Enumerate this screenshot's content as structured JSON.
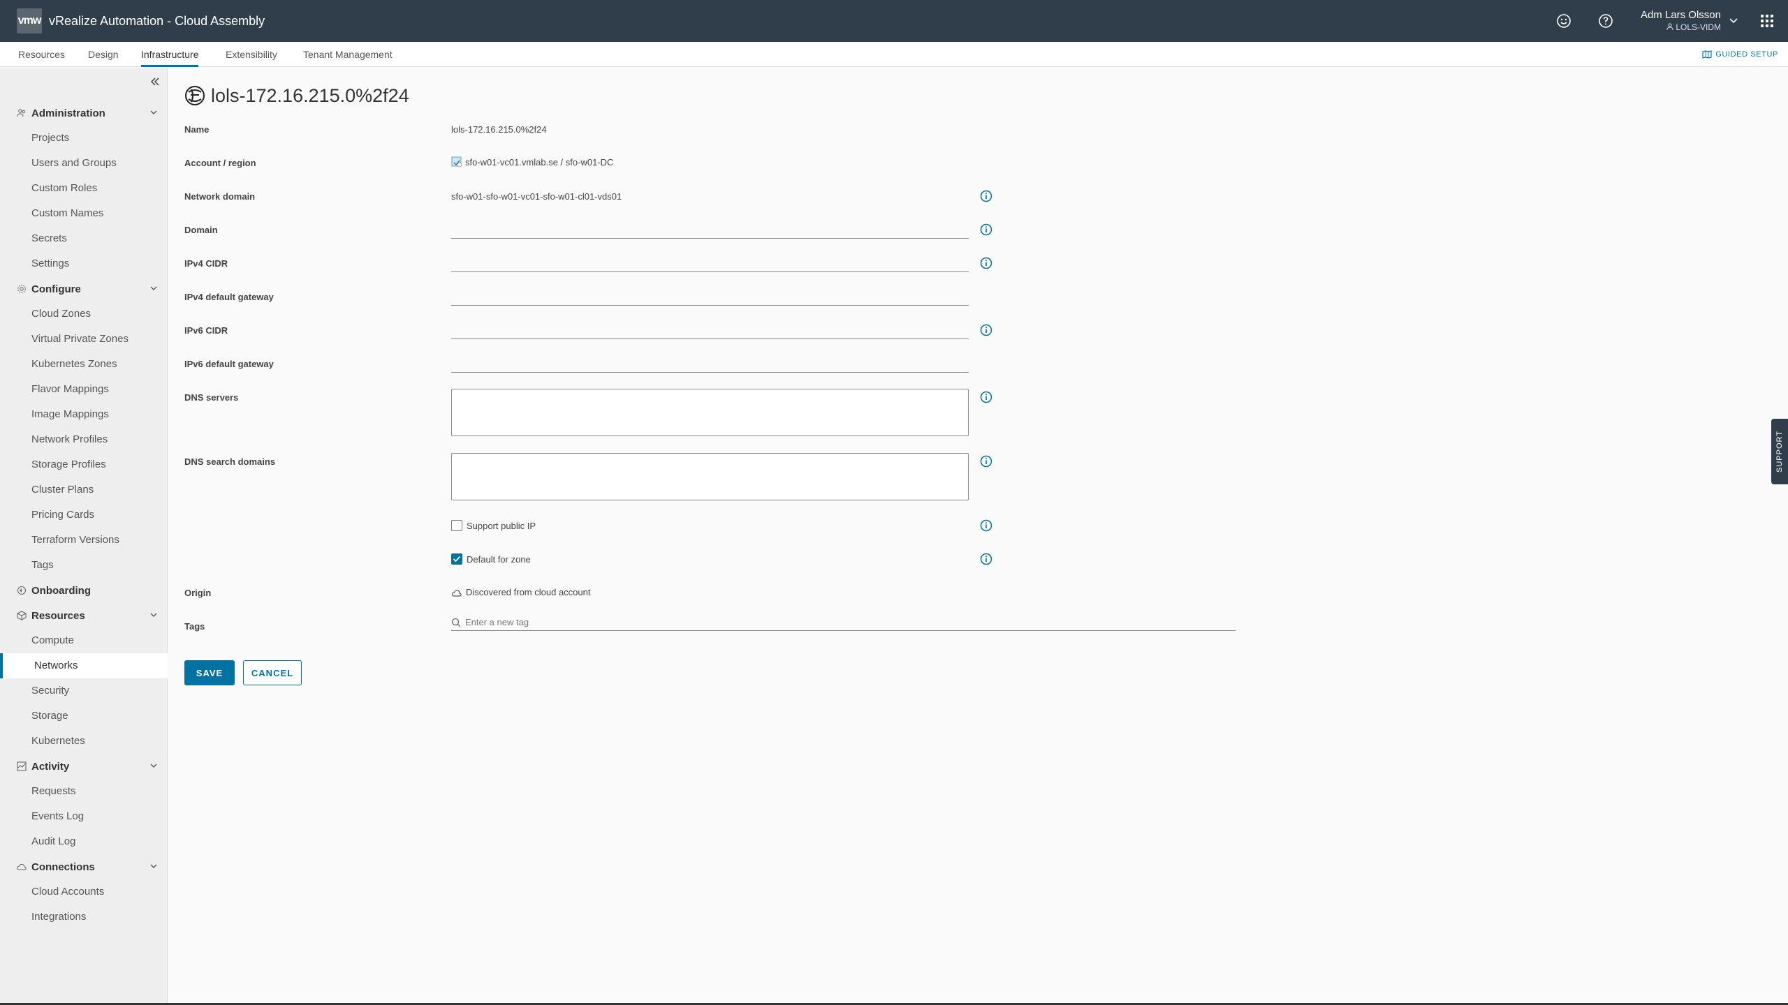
{
  "header": {
    "logo": "vmw",
    "title": "vRealize Automation - Cloud Assembly",
    "user_name": "Adm Lars Olsson",
    "user_tenant": "LOLS-VIDM",
    "icons": [
      "smiley-icon",
      "help-icon",
      "chevron-down-icon",
      "app-grid-icon"
    ]
  },
  "tabs": [
    "Resources",
    "Design",
    "Infrastructure",
    "Extensibility",
    "Tenant Management"
  ],
  "active_tab": "Infrastructure",
  "guided_setup": "GUIDED SETUP",
  "sidebar": {
    "groups": [
      {
        "label": "Administration",
        "icon": "users-icon",
        "items": [
          "Projects",
          "Users and Groups",
          "Custom Roles",
          "Custom Names",
          "Secrets",
          "Settings"
        ]
      },
      {
        "label": "Configure",
        "icon": "gear-icon",
        "items": [
          "Cloud Zones",
          "Virtual Private Zones",
          "Kubernetes Zones",
          "Flavor Mappings",
          "Image Mappings",
          "Network Profiles",
          "Storage Profiles",
          "Cluster Plans",
          "Pricing Cards",
          "Terraform Versions",
          "Tags"
        ]
      },
      {
        "label": "Onboarding",
        "icon": "onboarding-icon",
        "items": []
      },
      {
        "label": "Resources",
        "icon": "cube-icon",
        "items": [
          "Compute",
          "Networks",
          "Security",
          "Storage",
          "Kubernetes"
        ]
      },
      {
        "label": "Activity",
        "icon": "activity-icon",
        "items": [
          "Requests",
          "Events Log",
          "Audit Log"
        ]
      },
      {
        "label": "Connections",
        "icon": "cloud-icon",
        "items": [
          "Cloud Accounts",
          "Integrations"
        ]
      }
    ],
    "active_item": "Networks"
  },
  "page": {
    "title": "lols-172.16.215.0%2f24",
    "fields": {
      "name_label": "Name",
      "name_value": "lols-172.16.215.0%2f24",
      "account_label": "Account / region",
      "account_value": "sfo-w01-vc01.vmlab.se / sfo-w01-DC",
      "network_domain_label": "Network domain",
      "network_domain_value": "sfo-w01-sfo-w01-vc01-sfo-w01-cl01-vds01",
      "domain_label": "Domain",
      "domain_value": "",
      "ipv4_cidr_label": "IPv4 CIDR",
      "ipv4_cidr_value": "",
      "ipv4_gateway_label": "IPv4 default gateway",
      "ipv4_gateway_value": "",
      "ipv6_cidr_label": "IPv6 CIDR",
      "ipv6_cidr_value": "",
      "ipv6_gateway_label": "IPv6 default gateway",
      "ipv6_gateway_value": "",
      "dns_servers_label": "DNS servers",
      "dns_search_label": "DNS search domains",
      "support_public_ip_label": "Support public IP",
      "support_public_ip_checked": false,
      "default_for_zone_label": "Default for zone",
      "default_for_zone_checked": true,
      "origin_label": "Origin",
      "origin_value": "Discovered from cloud account",
      "tags_label": "Tags",
      "tags_placeholder": "Enter a new tag"
    },
    "save_label": "SAVE",
    "cancel_label": "CANCEL"
  },
  "support_label": "SUPPORT",
  "accent_color": "#0072a3",
  "header_color": "#2f3e4a"
}
